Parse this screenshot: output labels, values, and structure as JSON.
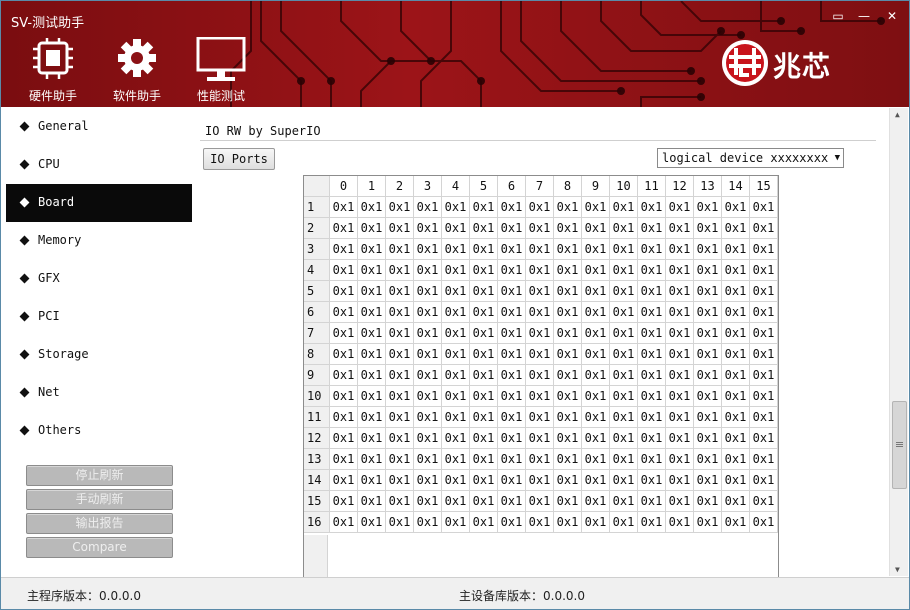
{
  "app": {
    "title": "SV-测试助手"
  },
  "window_controls": {
    "skin": "▭",
    "min": "—",
    "close": "✕"
  },
  "toolbar": [
    {
      "label": "硬件助手",
      "icon": "chip-icon"
    },
    {
      "label": "软件助手",
      "icon": "gear-icon"
    },
    {
      "label": "性能测试",
      "icon": "monitor-icon"
    }
  ],
  "brand": {
    "name": "兆芯",
    "color": "#c8141c"
  },
  "sidebar": {
    "items": [
      {
        "label": "General",
        "active": false
      },
      {
        "label": "CPU",
        "active": false
      },
      {
        "label": "Board",
        "active": true
      },
      {
        "label": "Memory",
        "active": false
      },
      {
        "label": "GFX",
        "active": false
      },
      {
        "label": "PCI",
        "active": false
      },
      {
        "label": "Storage",
        "active": false
      },
      {
        "label": "Net",
        "active": false
      },
      {
        "label": "Others",
        "active": false
      }
    ],
    "buttons": [
      "停止刷新",
      "手动刷新",
      "输出报告",
      "Compare"
    ]
  },
  "main": {
    "section_title": "IO RW by SuperIO",
    "io_ports_button": "IO Ports",
    "device_select": "logical device xxxxxxxx",
    "grid": {
      "columns": [
        "0",
        "1",
        "2",
        "3",
        "4",
        "5",
        "6",
        "7",
        "8",
        "9",
        "10",
        "11",
        "12",
        "13",
        "14",
        "15"
      ],
      "rows": [
        "1",
        "2",
        "3",
        "4",
        "5",
        "6",
        "7",
        "8",
        "9",
        "10",
        "11",
        "12",
        "13",
        "14",
        "15",
        "16"
      ],
      "cell_value": "0x1"
    }
  },
  "status": {
    "main_version": "主程序版本：0.0.0.0",
    "db_version": "主设备库版本：0.0.0.0"
  }
}
